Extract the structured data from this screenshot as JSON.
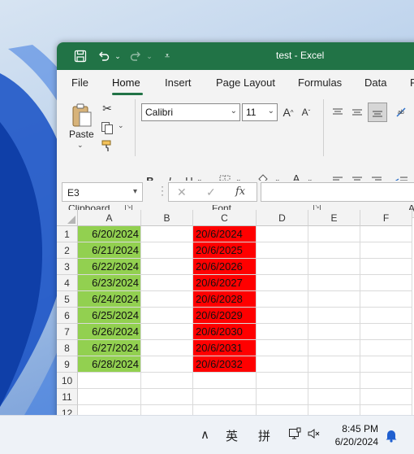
{
  "window": {
    "title": "test  -  Excel"
  },
  "tabs": [
    {
      "label": "File"
    },
    {
      "label": "Home"
    },
    {
      "label": "Insert"
    },
    {
      "label": "Page Layout"
    },
    {
      "label": "Formulas"
    },
    {
      "label": "Data"
    },
    {
      "label": "R"
    }
  ],
  "ribbon": {
    "clipboard": {
      "paste_label": "Paste",
      "group_label": "Clipboard"
    },
    "font": {
      "font_name": "Calibri",
      "font_size": "11",
      "group_label": "Font"
    },
    "alignment": {
      "group_label_partial": "A"
    }
  },
  "formula_bar": {
    "name_box": "E3",
    "fx_label": "fx",
    "formula": ""
  },
  "sheet": {
    "columns": [
      "A",
      "B",
      "C",
      "D",
      "E",
      "F"
    ],
    "rows": [
      "1",
      "2",
      "3",
      "4",
      "5",
      "6",
      "7",
      "8",
      "9",
      "10",
      "11",
      "12"
    ],
    "col_a": [
      "6/20/2024",
      "6/21/2024",
      "6/22/2024",
      "6/23/2024",
      "6/24/2024",
      "6/25/2024",
      "6/26/2024",
      "6/27/2024",
      "6/28/2024"
    ],
    "col_c": [
      "20/6/2024",
      "20/6/2025",
      "20/6/2026",
      "20/6/2027",
      "20/6/2028",
      "20/6/2029",
      "20/6/2030",
      "20/6/2031",
      "20/6/2032"
    ],
    "fill_a": "#92d050",
    "fill_c": "#ff0000"
  },
  "taskbar": {
    "ime_1": "英",
    "ime_2": "拼",
    "time": "8:45 PM",
    "date": "6/20/2024"
  }
}
